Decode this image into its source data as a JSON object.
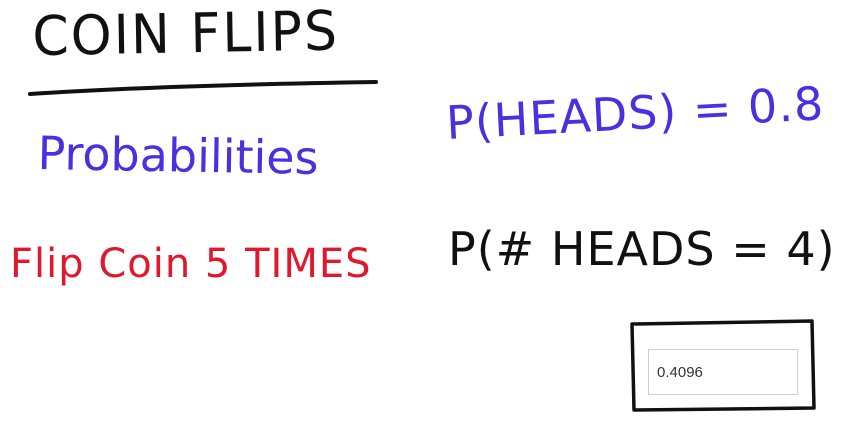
{
  "whiteboard": {
    "title": "COIN FLIPS",
    "topic": "Probabilities",
    "heads_probability": "P(HEADS) = 0.8",
    "experiment": "Flip Coin 5 TIMES",
    "question": "P(# HEADS = 4)"
  },
  "answer": {
    "value": "0.4096"
  },
  "colors": {
    "ink_black": "#111111",
    "ink_blue": "#4b2fe0",
    "ink_red": "#e0182d",
    "input_border": "#cfcfcf"
  }
}
